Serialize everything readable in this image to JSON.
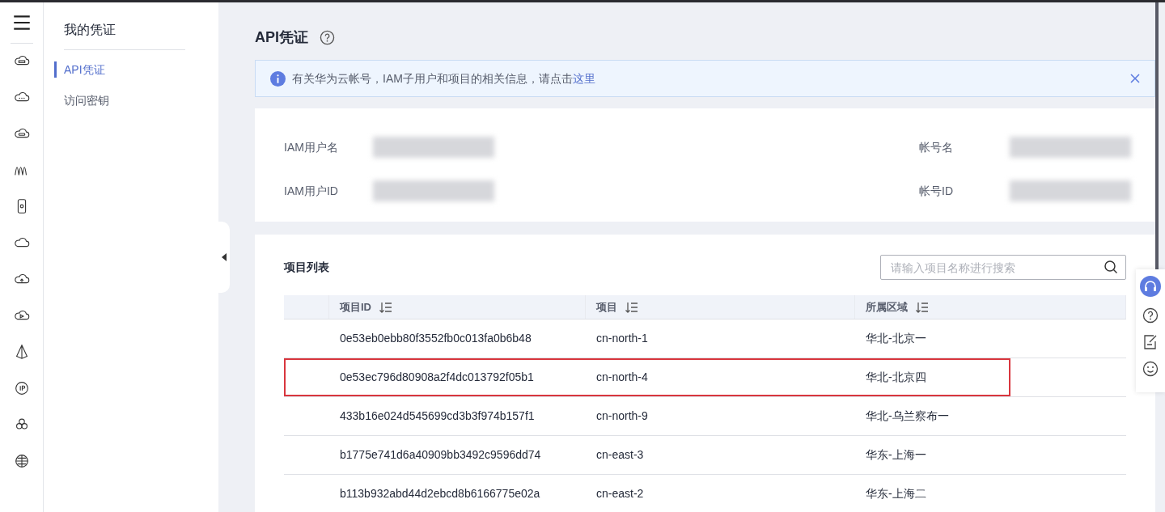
{
  "sidebar": {
    "title": "我的凭证",
    "items": [
      {
        "label": "API凭证",
        "selected": true
      },
      {
        "label": "访问密钥",
        "selected": false
      }
    ]
  },
  "page_title": "API凭证",
  "alert": {
    "text": "有关华为云帐号，IAM子用户和项目的相关信息，请点击",
    "link": "这里"
  },
  "account_info": {
    "fields": [
      {
        "label": "IAM用户名"
      },
      {
        "label": "IAM用户ID"
      },
      {
        "label": "帐号名"
      },
      {
        "label": "帐号ID"
      }
    ]
  },
  "project_list": {
    "title": "项目列表",
    "search": {
      "placeholder": "请输入项目名称进行搜索"
    },
    "columns": [
      "项目ID",
      "项目",
      "所属区域"
    ],
    "rows": [
      {
        "cells": [
          "0e53eb0ebb80f3552fb0c013fa0b6b48",
          "cn-north-1",
          "华北-北京一"
        ],
        "highlighted": false
      },
      {
        "cells": [
          "0e53ec796d80908a2f4dc013792f05b1",
          "cn-north-4",
          "华北-北京四"
        ],
        "highlighted": true
      },
      {
        "cells": [
          "433b16e024d545699cd3b3f974b157f1",
          "cn-north-9",
          "华北-乌兰察布一"
        ],
        "highlighted": false
      },
      {
        "cells": [
          "b1775e741d6a40909bb3492c9596dd74",
          "cn-east-3",
          "华东-上海一"
        ],
        "highlighted": false
      },
      {
        "cells": [
          "b113b932abd44d2ebcd8b6166775e02a",
          "cn-east-2",
          "华东-上海二"
        ],
        "highlighted": false
      }
    ]
  }
}
